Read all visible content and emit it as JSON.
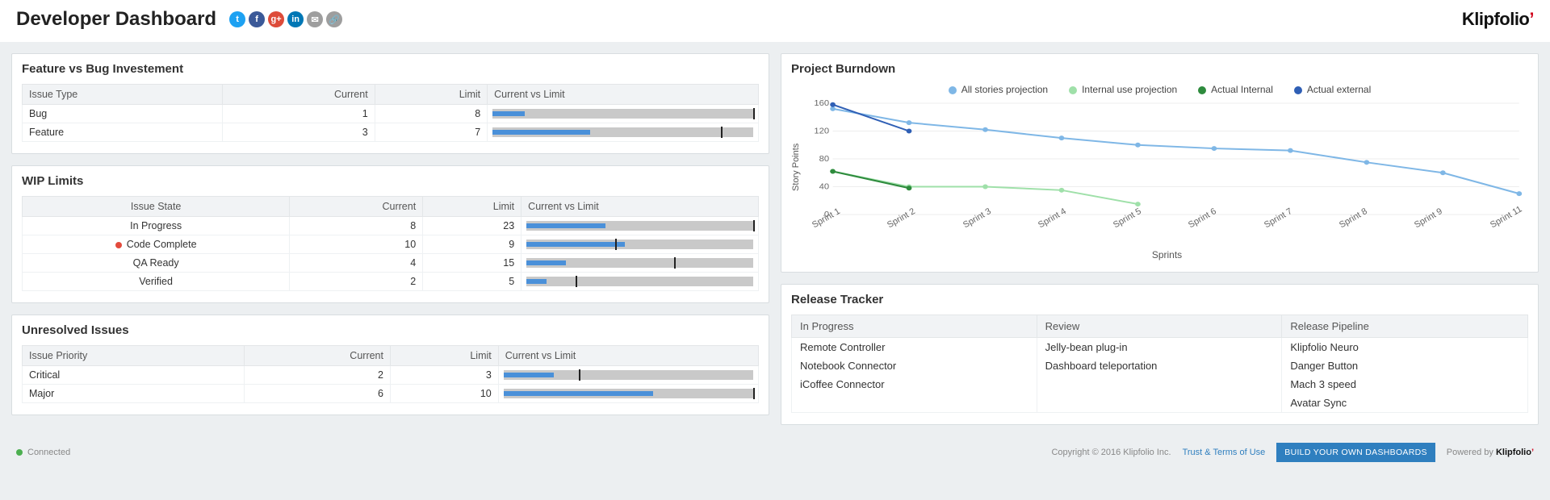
{
  "header": {
    "title": "Developer Dashboard",
    "brand": "Klipfolio",
    "social": [
      {
        "name": "twitter",
        "glyph": "t",
        "bg": "#1da1f2"
      },
      {
        "name": "facebook",
        "glyph": "f",
        "bg": "#3b5998"
      },
      {
        "name": "google-plus",
        "glyph": "g+",
        "bg": "#dd4b39"
      },
      {
        "name": "linkedin",
        "glyph": "in",
        "bg": "#0077b5"
      },
      {
        "name": "email",
        "glyph": "✉",
        "bg": "#9e9e9e"
      },
      {
        "name": "link",
        "glyph": "🔗",
        "bg": "#9e9e9e"
      }
    ]
  },
  "cards": {
    "feature_bug": {
      "title": "Feature vs Bug Investement",
      "cols": [
        "Issue Type",
        "Current",
        "Limit",
        "Current vs Limit"
      ],
      "rows": [
        {
          "type": "Bug",
          "current": 1,
          "limit": 8
        },
        {
          "type": "Feature",
          "current": 3,
          "limit": 7
        }
      ]
    },
    "wip": {
      "title": "WIP Limits",
      "cols": [
        "Issue State",
        "Current",
        "Limit",
        "Current vs Limit"
      ],
      "rows": [
        {
          "state": "In Progress",
          "current": 8,
          "limit": 23,
          "alert": false
        },
        {
          "state": "Code Complete",
          "current": 10,
          "limit": 9,
          "alert": true
        },
        {
          "state": "QA Ready",
          "current": 4,
          "limit": 15,
          "alert": false
        },
        {
          "state": "Verified",
          "current": 2,
          "limit": 5,
          "alert": false
        }
      ]
    },
    "unresolved": {
      "title": "Unresolved Issues",
      "cols": [
        "Issue Priority",
        "Current",
        "Limit",
        "Current vs Limit"
      ],
      "rows": [
        {
          "priority": "Critical",
          "current": 2,
          "limit": 3
        },
        {
          "priority": "Major",
          "current": 6,
          "limit": 10
        }
      ]
    },
    "burndown": {
      "title": "Project Burndown",
      "ylabel": "Story Points",
      "xlabel": "Sprints",
      "legend": [
        "All stories projection",
        "Internal use projection",
        "Actual Internal",
        "Actual external"
      ]
    },
    "release": {
      "title": "Release Tracker",
      "columns": [
        "In Progress",
        "Review",
        "Release Pipeline"
      ],
      "data": {
        "In Progress": [
          "Remote Controller",
          "Notebook Connector",
          "iCoffee Connector"
        ],
        "Review": [
          "Jelly-bean plug-in",
          "Dashboard teleportation"
        ],
        "Release Pipeline": [
          "Klipfolio Neuro",
          "Danger Button",
          "Mach 3 speed",
          "Avatar Sync"
        ]
      }
    }
  },
  "chart_data": {
    "type": "line",
    "title": "Project Burndown",
    "xlabel": "Sprints",
    "ylabel": "Story Points",
    "ylim": [
      0,
      160
    ],
    "categories": [
      "Sprint 1",
      "Sprint 2",
      "Sprint 3",
      "Sprint 4",
      "Sprint 5",
      "Sprint 6",
      "Sprint 7",
      "Sprint 8",
      "Sprint 9",
      "Sprint 11"
    ],
    "series": [
      {
        "name": "All stories projection",
        "color": "#7fb7e6",
        "values": [
          152,
          132,
          122,
          110,
          100,
          95,
          92,
          75,
          60,
          30
        ]
      },
      {
        "name": "Internal use projection",
        "color": "#9fe0a9",
        "values": [
          62,
          40,
          40,
          35,
          15,
          null,
          null,
          null,
          null,
          null
        ]
      },
      {
        "name": "Actual Internal",
        "color": "#2e8b3d",
        "values": [
          62,
          38,
          null,
          null,
          null,
          null,
          null,
          null,
          null,
          null
        ]
      },
      {
        "name": "Actual external",
        "color": "#2f5fb5",
        "values": [
          158,
          120,
          null,
          null,
          null,
          null,
          null,
          null,
          null,
          null
        ]
      }
    ]
  },
  "footer": {
    "status": "Connected",
    "copyright": "Copyright © 2016 Klipfolio Inc.",
    "terms": "Trust & Terms of Use",
    "cta": "BUILD YOUR OWN DASHBOARDS",
    "powered": "Powered by",
    "brand": "Klipfolio"
  }
}
